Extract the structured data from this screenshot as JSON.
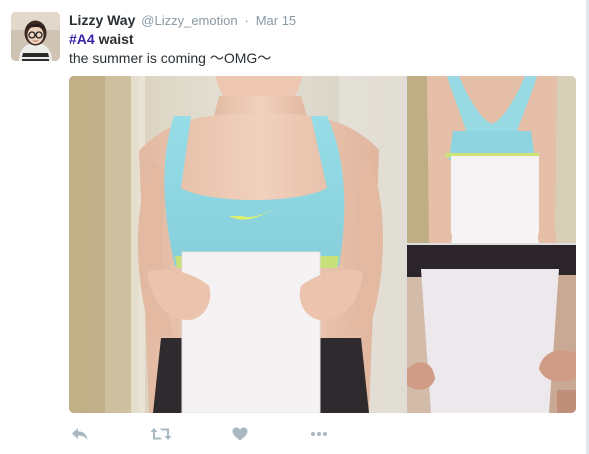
{
  "tweet": {
    "fullname": "Lizzy Way",
    "username": "@Lizzy_emotion",
    "separator": "·",
    "time": "Mar 15",
    "hashtag": "#A4",
    "hashtag_rest": " waist",
    "text_line2": "the summer is coming ～OMG～"
  },
  "colors": {
    "hashtag": "#3b1fa8",
    "muted": "#8899a6",
    "action_icon": "#aab8c2",
    "text": "#292f33"
  },
  "actions": {
    "reply_icon": "reply-icon",
    "retweet_icon": "retweet-icon",
    "like_icon": "heart-icon",
    "more_icon": "more-icon"
  }
}
